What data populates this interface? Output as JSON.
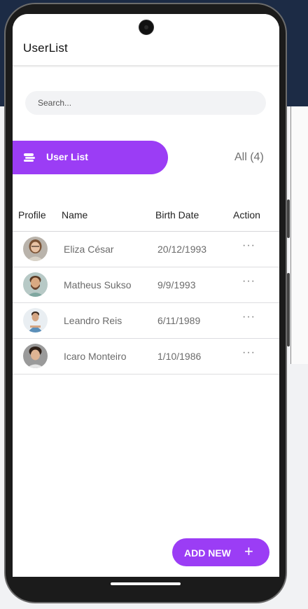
{
  "app": {
    "title": "UserList"
  },
  "search": {
    "placeholder": "Search..."
  },
  "tabs": {
    "active_label": "User List",
    "count_label": "All (4)"
  },
  "table": {
    "headers": {
      "profile": "Profile",
      "name": "Name",
      "birth_date": "Birth Date",
      "action": "Action"
    },
    "rows": [
      {
        "name": "Eliza César",
        "birth_date": "20/12/1993",
        "action": "···"
      },
      {
        "name": "Matheus Sukso",
        "birth_date": "9/9/1993",
        "action": "···"
      },
      {
        "name": "Leandro Reis",
        "birth_date": "6/11/1989",
        "action": "···"
      },
      {
        "name": "Icaro Monteiro",
        "birth_date": "1/10/1986",
        "action": "···"
      }
    ]
  },
  "fab": {
    "label": "ADD NEW",
    "icon": "+"
  },
  "colors": {
    "accent": "#9b3df5"
  }
}
